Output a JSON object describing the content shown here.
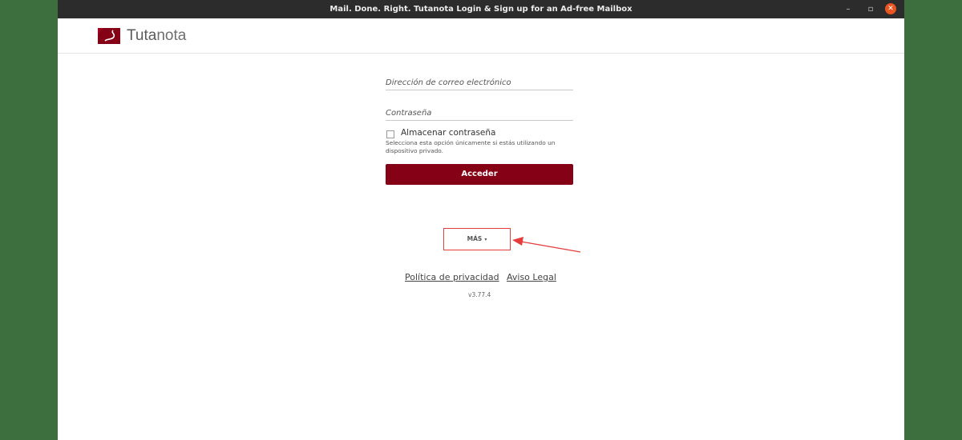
{
  "window": {
    "title": "Mail. Done. Right. Tutanota Login & Sign up for an Ad-free Mailbox",
    "controls": {
      "minimize": "–",
      "maximize": "▫",
      "close": "✕"
    }
  },
  "brand": {
    "part1": "Tuta",
    "part2": "nota"
  },
  "login": {
    "email_placeholder": "Dirección de correo electrónico",
    "password_placeholder": "Contraseña",
    "remember_label": "Almacenar contraseña",
    "remember_help": "Selecciona esta opción únicamente si estás utilizando un dispositivo privado.",
    "submit_label": "Acceder"
  },
  "more": {
    "label": "MÁS",
    "caret": "▾"
  },
  "footer": {
    "privacy_label": "Política de privacidad",
    "legal_label": "Aviso Legal",
    "version": "v3.77.4"
  },
  "colors": {
    "accent": "#850116",
    "annotation": "#e53c3c",
    "desktop": "#3c6b3d"
  }
}
